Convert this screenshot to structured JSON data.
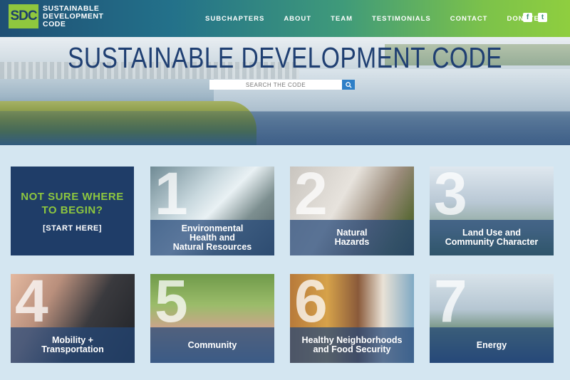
{
  "header": {
    "logo_mark": "SDC",
    "logo_lines": [
      "SUSTAINABLE",
      "DEVELOPMENT",
      "CODE"
    ],
    "menu": [
      "SUBCHAPTERS",
      "ABOUT",
      "TEAM",
      "TESTIMONIALS",
      "CONTACT",
      "DONATE"
    ],
    "social": [
      {
        "icon": "facebook-icon",
        "glyph": "f"
      },
      {
        "icon": "twitter-icon",
        "glyph": "t"
      }
    ]
  },
  "hero": {
    "title": "SUSTAINABLE DEVELOPMENT CODE",
    "search_placeholder": "SEARCH THE CODE",
    "search_icon": "search-icon"
  },
  "start": {
    "question": "NOT SURE WHERE\nTO BEGIN?",
    "link": "[START HERE]"
  },
  "tiles": [
    {
      "num": "1",
      "label": "Environmental\nHealth and\nNatural Resources"
    },
    {
      "num": "2",
      "label": "Natural\nHazards"
    },
    {
      "num": "3",
      "label": "Land Use and\nCommunity Character"
    },
    {
      "num": "4",
      "label": "Mobility +\nTransportation"
    },
    {
      "num": "5",
      "label": "Community"
    },
    {
      "num": "6",
      "label": "Healthy Neighborhoods\nand Food Security"
    },
    {
      "num": "7",
      "label": "Energy"
    }
  ],
  "colors": {
    "brand_navy": "#1f3d68",
    "brand_green": "#8dc63f",
    "page_bg": "#d4e6f1"
  }
}
